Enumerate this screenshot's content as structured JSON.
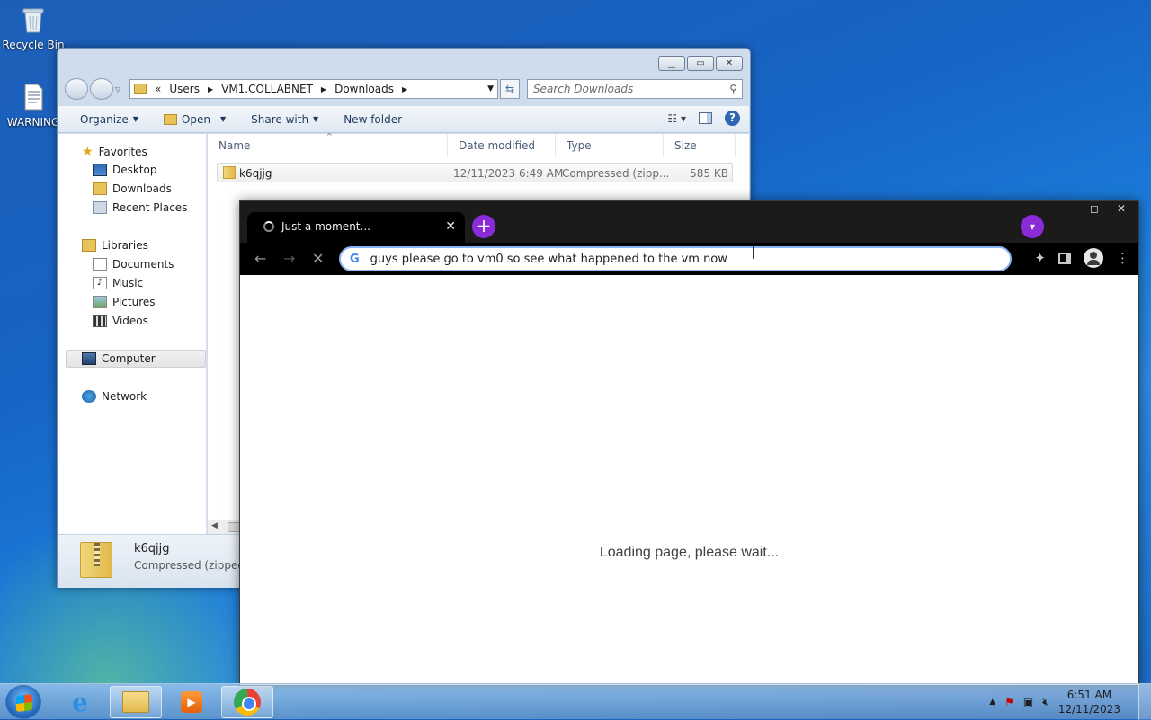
{
  "desktop": {
    "icons": [
      {
        "label": "Recycle Bin"
      },
      {
        "label": "WARNING"
      }
    ]
  },
  "explorer": {
    "address": {
      "prefix": "«",
      "segments": [
        "Users",
        "VM1.COLLABNET",
        "Downloads"
      ]
    },
    "search_placeholder": "Search Downloads",
    "toolbar": {
      "organize": "Organize",
      "open": "Open",
      "share_with": "Share with",
      "new_folder": "New folder"
    },
    "sidebar": {
      "favorites": "Favorites",
      "desktop": "Desktop",
      "downloads": "Downloads",
      "recent_places": "Recent Places",
      "libraries": "Libraries",
      "documents": "Documents",
      "music": "Music",
      "pictures": "Pictures",
      "videos": "Videos",
      "computer": "Computer",
      "network": "Network"
    },
    "columns": {
      "name": "Name",
      "date_modified": "Date modified",
      "type": "Type",
      "size": "Size"
    },
    "files": [
      {
        "name": "k6qjjg",
        "date": "12/11/2023 6:49 AM",
        "type": "Compressed (zipp...",
        "size": "585 KB"
      }
    ],
    "details": {
      "name": "k6qjjg",
      "type": "Compressed (zipped) F"
    }
  },
  "chrome": {
    "tab_title": "Just a moment...",
    "url_text": "guys please go to vm0 so see what happened to the vm now",
    "loading_text": "Loading page, please wait..."
  },
  "taskbar": {
    "time": "6:51 AM",
    "date": "12/11/2023"
  },
  "colors": {
    "accent_purple": "#8b2ad8",
    "url_focus": "#8ab4f8"
  }
}
